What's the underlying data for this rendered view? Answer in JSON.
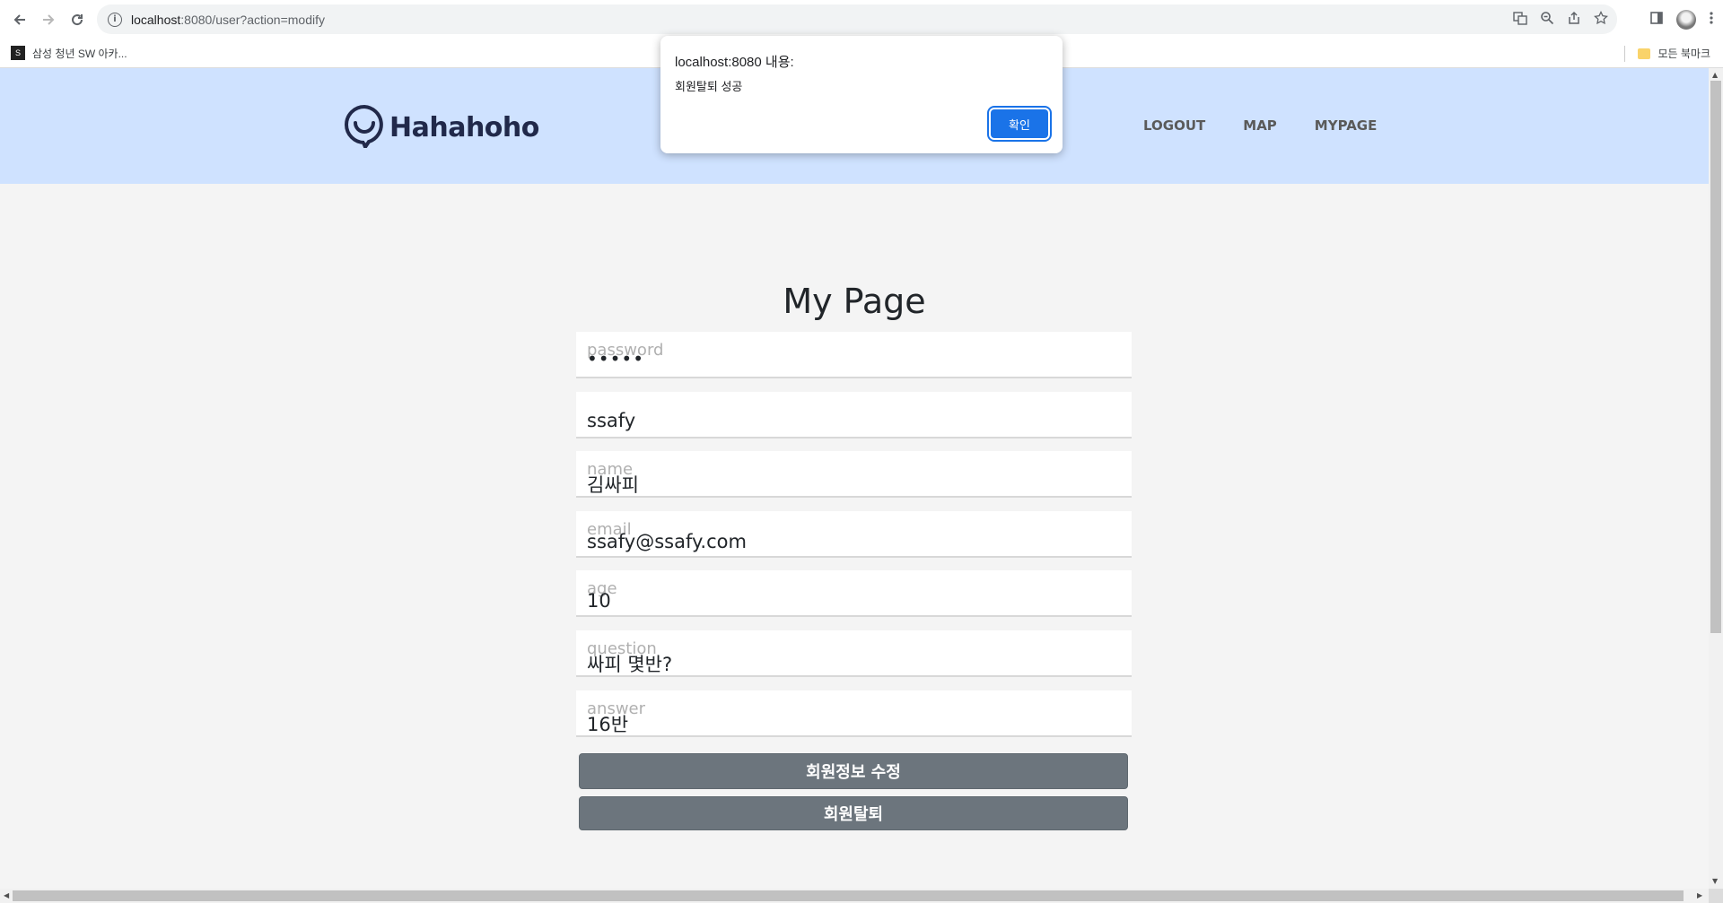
{
  "browser": {
    "url_host": "localhost",
    "url_path": ":8080/user?action=modify",
    "bookmark_label": "삼성 청년 SW 아카...",
    "bookmark_favicon": "S",
    "all_bookmarks_label": "모든 북마크"
  },
  "header": {
    "logo_text": "Hahahoho",
    "nav": [
      "LOGOUT",
      "MAP",
      "MYPAGE"
    ]
  },
  "main": {
    "title": "My Page",
    "fields": [
      {
        "placeholder": "password",
        "value": "•••••"
      },
      {
        "placeholder": "",
        "value": "ssafy"
      },
      {
        "placeholder": "name",
        "value": "김싸피"
      },
      {
        "placeholder": "email",
        "value": "ssafy@ssafy.com"
      },
      {
        "placeholder": "age",
        "value": "10"
      },
      {
        "placeholder": "question",
        "value": "싸피 몇반?"
      },
      {
        "placeholder": "answer",
        "value": "16반"
      }
    ],
    "modify_button": "회원정보 수정",
    "withdraw_button": "회원탈퇴"
  },
  "dialog": {
    "title": "localhost:8080 내용:",
    "message": "회원탈퇴 성공",
    "ok_label": "확인"
  }
}
